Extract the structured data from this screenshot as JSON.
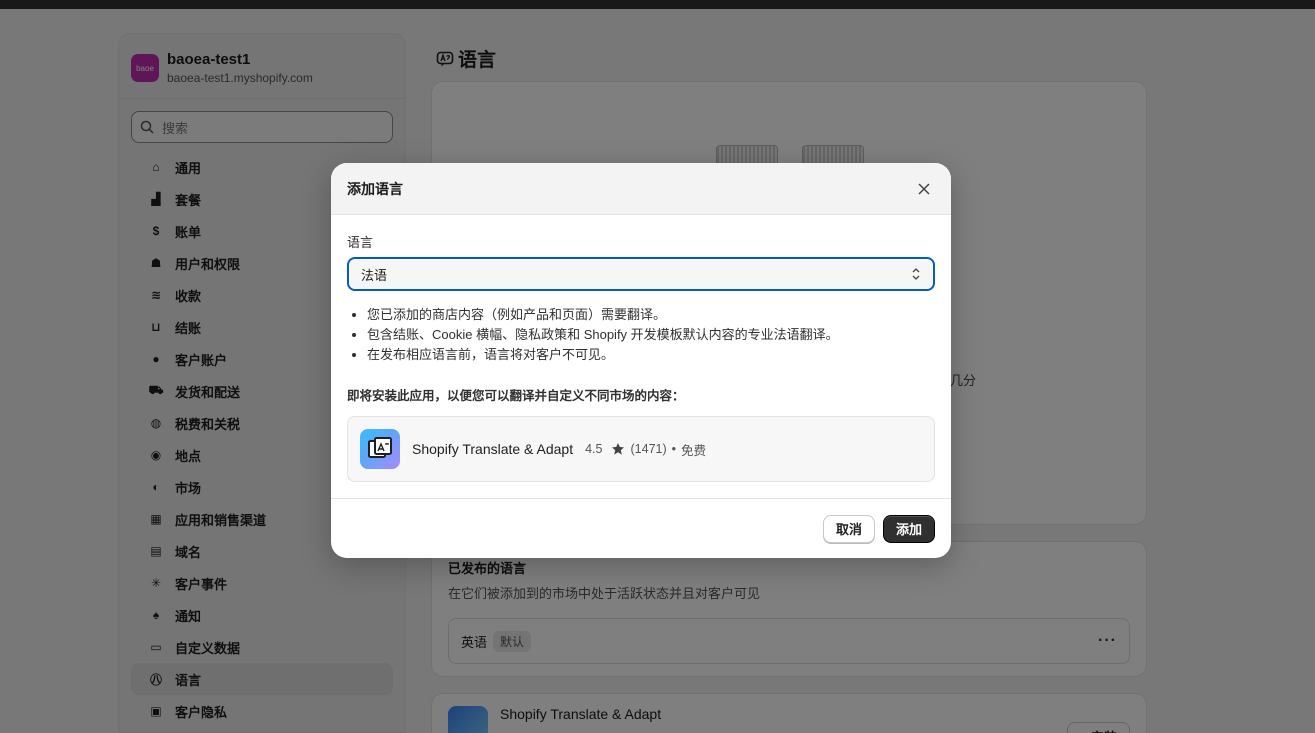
{
  "store": {
    "logo_text": "baoe",
    "name": "baoea-test1",
    "domain": "baoea-test1.myshopify.com"
  },
  "search": {
    "placeholder": "搜索"
  },
  "sidebar": {
    "items": [
      {
        "label": "通用",
        "icon": "store-icon"
      },
      {
        "label": "套餐",
        "icon": "plan-chart-icon"
      },
      {
        "label": "账单",
        "icon": "billing-receipt-icon"
      },
      {
        "label": "用户和权限",
        "icon": "users-icon"
      },
      {
        "label": "收款",
        "icon": "payments-icon"
      },
      {
        "label": "结账",
        "icon": "cart-icon"
      },
      {
        "label": "客户账户",
        "icon": "person-icon"
      },
      {
        "label": "发货和配送",
        "icon": "truck-icon"
      },
      {
        "label": "税费和关税",
        "icon": "tax-bag-icon"
      },
      {
        "label": "地点",
        "icon": "location-pin-icon"
      },
      {
        "label": "市场",
        "icon": "globe-icon"
      },
      {
        "label": "应用和销售渠道",
        "icon": "apps-icon"
      },
      {
        "label": "域名",
        "icon": "domain-icon"
      },
      {
        "label": "客户事件",
        "icon": "cursor-click-icon"
      },
      {
        "label": "通知",
        "icon": "bell-icon"
      },
      {
        "label": "自定义数据",
        "icon": "database-icon"
      },
      {
        "label": "语言",
        "icon": "language-icon",
        "active": true
      },
      {
        "label": "客户隐私",
        "icon": "lock-icon"
      }
    ]
  },
  "main": {
    "title": "语言",
    "card1_fragment": "要几分",
    "published": {
      "title": "已发布的语言",
      "subtitle": "在它们被添加到的市场中处于活跃状态并且对客户可见",
      "language": "英语",
      "badge": "默认",
      "more": "···"
    },
    "app_card": {
      "name": "Shopify Translate & Adapt",
      "install": "+ 安装"
    }
  },
  "modal": {
    "title": "添加语言",
    "field_label": "语言",
    "selected_language": "法语",
    "bullets": [
      "您已添加的商店内容（例如产品和页面）需要翻译。",
      "包含结账、Cookie 横幅、隐私政策和 Shopify 开发模板默认内容的专业法语翻译。",
      "在发布相应语言前，语言将对客户不可见。"
    ],
    "install_note": "即将安装此应用，以便您可以翻译并自定义不同市场的内容：",
    "app": {
      "name": "Shopify Translate & Adapt",
      "rating": "4.5",
      "reviews": "(1471)",
      "separator": "•",
      "price": "免费"
    },
    "cancel_label": "取消",
    "add_label": "添加"
  },
  "colors": {
    "focus_ring": "#005bd3",
    "primary_button": "#303030",
    "store_logo": "#c02bb3"
  }
}
